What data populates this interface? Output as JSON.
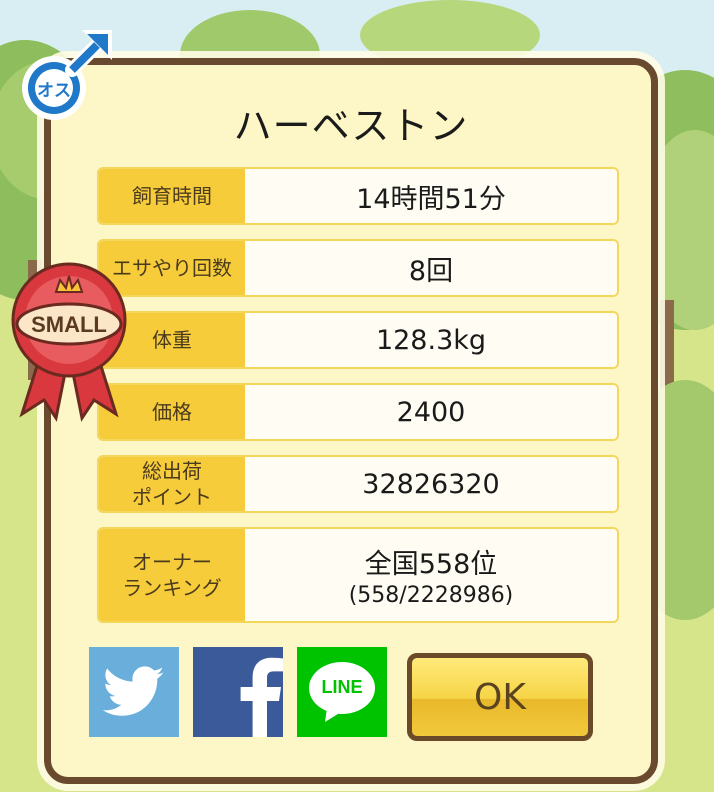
{
  "pig": {
    "name": "ハーベストン",
    "gender_badge": "オス",
    "size_badge": "SMALL"
  },
  "stats": [
    {
      "label": "飼育時間",
      "value": "14時間51分",
      "sub": ""
    },
    {
      "label": "エサやり回数",
      "value": "8回",
      "sub": ""
    },
    {
      "label": "体重",
      "value": "128.3kg",
      "sub": ""
    },
    {
      "label": "価格",
      "value": "2400",
      "sub": ""
    },
    {
      "label": "総出荷\nポイント",
      "value": "32826320",
      "sub": ""
    },
    {
      "label": "オーナー\nランキング",
      "value": "全国558位",
      "sub": "(558/2228986)"
    }
  ],
  "share": {
    "twitter_icon": "twitter-bird-icon",
    "facebook_icon": "facebook-f-icon",
    "line_label": "LINE"
  },
  "ok_label": "OK",
  "colors": {
    "frame": "#6a4a2e",
    "panel": "#fdf6c6",
    "label_bg": "#f7cc3a",
    "twitter": "#55acee",
    "facebook": "#3b5998",
    "line": "#00c300",
    "gender_blue": "#1f78c8",
    "ribbon_red": "#d8383e"
  }
}
